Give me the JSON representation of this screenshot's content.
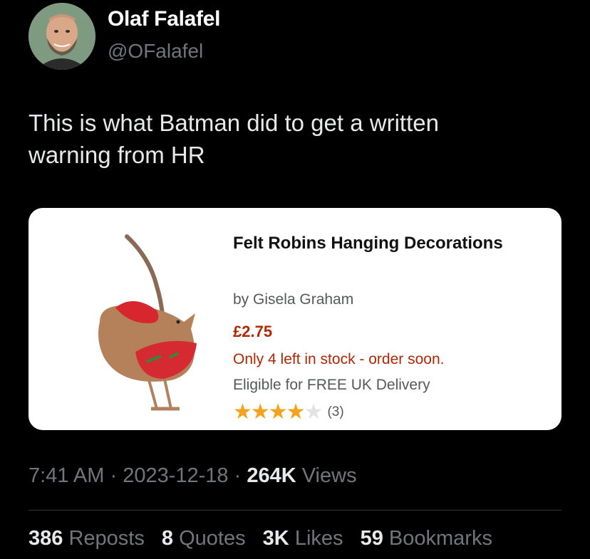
{
  "author": {
    "display_name": "Olaf Falafel",
    "handle": "@OFalafel",
    "avatar_icon": "profile-photo"
  },
  "tweet": {
    "text": "This is what Batman did to get a written warning from HR"
  },
  "product_card": {
    "image_icon": "felt-robin-ornament",
    "title": "Felt Robins Hanging Decorations",
    "byline": "by Gisela Graham",
    "price": "£2.75",
    "stock_notice": "Only 4 left in stock - order soon.",
    "delivery_notice": "Eligible for FREE UK Delivery",
    "rating_stars": 4,
    "rating_max": 5,
    "review_count": "(3)",
    "colors": {
      "price": "#b12704",
      "stock": "#b12704",
      "star": "#f4a41c"
    }
  },
  "meta": {
    "time": "7:41 AM",
    "separator": "·",
    "date": "2023-12-18",
    "views_count": "264K",
    "views_label": "Views"
  },
  "stats": {
    "reposts_count": "386",
    "reposts_label": "Reposts",
    "quotes_count": "8",
    "quotes_label": "Quotes",
    "likes_count": "3K",
    "likes_label": "Likes",
    "bookmarks_count": "59",
    "bookmarks_label": "Bookmarks"
  },
  "colors": {
    "background": "#000000",
    "primary_text": "#e7e9ea",
    "secondary_text": "#71767b"
  }
}
